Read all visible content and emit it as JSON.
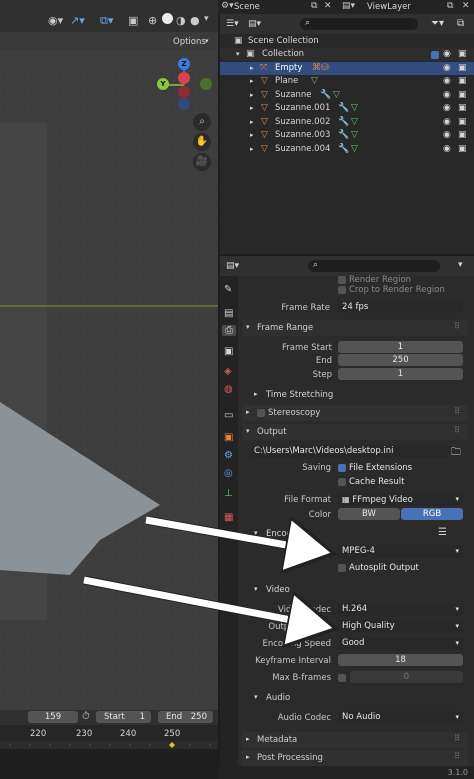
{
  "header": {
    "scene_label": "Scene",
    "view_layer_label": "ViewLayer",
    "options_label": "Options"
  },
  "gizmo": {
    "z": "Z",
    "y": "Y"
  },
  "outliner": {
    "items": [
      {
        "label": "Scene Collection"
      },
      {
        "label": "Collection"
      },
      {
        "label": "Empty"
      },
      {
        "label": "Plane"
      },
      {
        "label": "Suzanne"
      },
      {
        "label": "Suzanne.001"
      },
      {
        "label": "Suzanne.002"
      },
      {
        "label": "Suzanne.003"
      },
      {
        "label": "Suzanne.004"
      }
    ]
  },
  "properties": {
    "render_region": "Render Region",
    "crop_region": "Crop to Render Region",
    "frame_rate_label": "Frame Rate",
    "frame_rate_value": "24 fps",
    "frame_range_title": "Frame Range",
    "frame_start_label": "Frame Start",
    "frame_start_value": "1",
    "end_label": "End",
    "end_value": "250",
    "step_label": "Step",
    "step_value": "1",
    "time_stretching": "Time Stretching",
    "stereoscopy": "Stereoscopy",
    "output_title": "Output",
    "output_path": "C:\\Users\\Marc\\Videos\\desktop.ini",
    "saving_label": "Saving",
    "file_extensions": "File Extensions",
    "cache_result": "Cache Result",
    "file_format_label": "File Format",
    "file_format_value": "FFmpeg Video",
    "color_label": "Color",
    "bw": "BW",
    "rgb": "RGB",
    "encoding_title": "Encoding",
    "container_value": "MPEG-4",
    "autosplit": "Autosplit Output",
    "video_title": "Video",
    "video_codec_label": "Video Codec",
    "video_codec_value": "H.264",
    "output_quality_label": "Output Quality",
    "output_quality_value": "High Quality",
    "encoding_speed_label": "Encoding Speed",
    "encoding_speed_value": "Good",
    "keyframe_label": "Keyframe Interval",
    "keyframe_value": "18",
    "max_b_label": "Max B-frames",
    "max_b_value": "0",
    "audio_title": "Audio",
    "audio_codec_label": "Audio Codec",
    "audio_codec_value": "No Audio",
    "metadata_title": "Metadata",
    "post_processing_title": "Post Processing"
  },
  "timeline": {
    "current_frame": "159",
    "start_label": "Start",
    "start_value": "1",
    "end_label": "End",
    "end_value": "250",
    "ticks": [
      "220",
      "230",
      "240",
      "250"
    ]
  },
  "version": "3.1.0",
  "colors": {
    "accent": "#4772b3",
    "selected_row": "#334d80",
    "orange_icon": "#e8873a",
    "green_icon": "#6cc070"
  }
}
